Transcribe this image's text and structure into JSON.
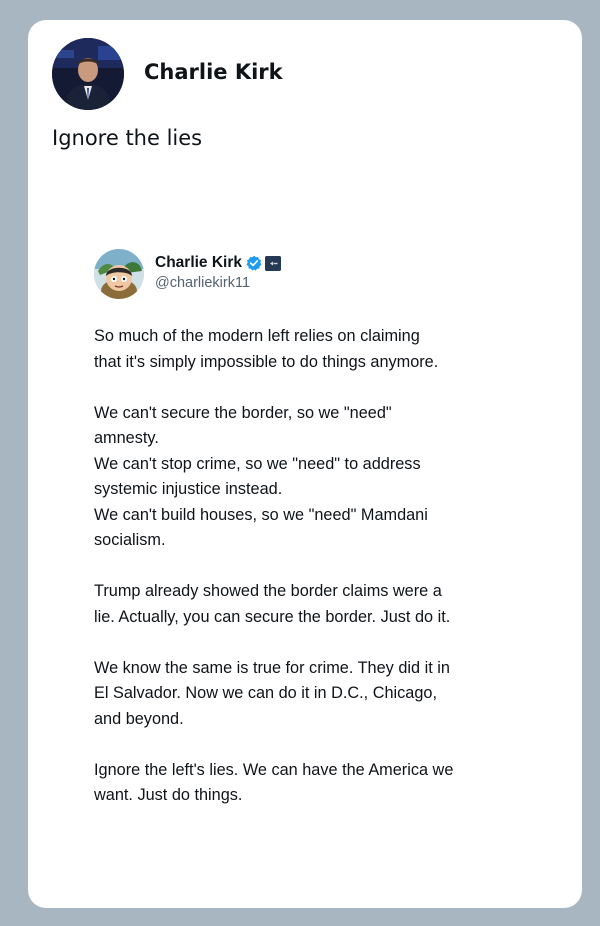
{
  "post": {
    "author_name": "Charlie Kirk",
    "text": "Ignore the lies"
  },
  "quoted_tweet": {
    "author_name": "Charlie Kirk",
    "handle": "@charliekirk11",
    "paragraphs": [
      [
        "So much of the modern left relies on claiming",
        "that it's simply impossible to do things anymore."
      ],
      [
        "We can't secure the border, so we \"need\"",
        "amnesty.",
        "We can't stop crime, so we \"need\" to address",
        "systemic injustice instead.",
        "We can't build houses, so we \"need\" Mamdani",
        "socialism."
      ],
      [
        "Trump already showed the border claims were a",
        "lie. Actually, you can secure the border. Just do it."
      ],
      [
        "We know the same is true for crime. They did it in",
        "El Salvador. Now we can do it in D.C., Chicago,",
        "and beyond."
      ],
      [
        "Ignore the left's lies. We can have the America we",
        "want. Just do things."
      ]
    ]
  },
  "colors": {
    "background": "#a7b6c0",
    "card": "#ffffff",
    "text": "#0f1419",
    "handle": "#536471",
    "verified": "#1d9bf0"
  },
  "icons": {
    "verified": "verified-badge-icon",
    "affiliate": "affiliate-badge-icon"
  }
}
